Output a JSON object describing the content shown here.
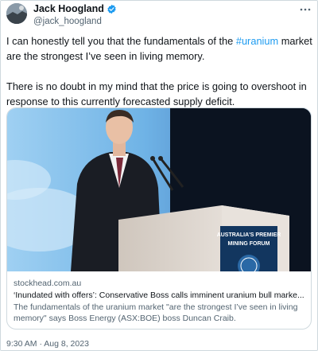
{
  "author": {
    "name": "Jack Hoogland",
    "handle": "@jack_hoogland",
    "verified": true,
    "avatar_icon": "profile-avatar"
  },
  "tweet": {
    "line1_prefix": "I can honestly tell you that the fundamentals of the ",
    "hashtag": "#uranium",
    "line1_suffix": " market are the strongest I’ve seen in living memory.",
    "paragraph2": "There is no doubt in my mind that the price is going to overshoot in response to this currently forecasted supply deficit."
  },
  "card": {
    "domain": "stockhead.com.au",
    "title": "‘Inundated with offers’: Conservative Boss calls imminent uranium bull marke...",
    "description": "The fundamentals of the uranium market \"are the strongest I’ve seen in living memory\" says Boss Energy (ASX:BOE) boss Duncan Craib.",
    "image": {
      "podium_sign_line1": "AUSTRALIA'S PREMIER",
      "podium_sign_line2": "MINING FORUM"
    }
  },
  "timestamp": "9:30 AM · Aug 8, 2023",
  "colors": {
    "accent": "#1d9bf0",
    "secondary_text": "#536471",
    "border": "#cfd9de"
  }
}
